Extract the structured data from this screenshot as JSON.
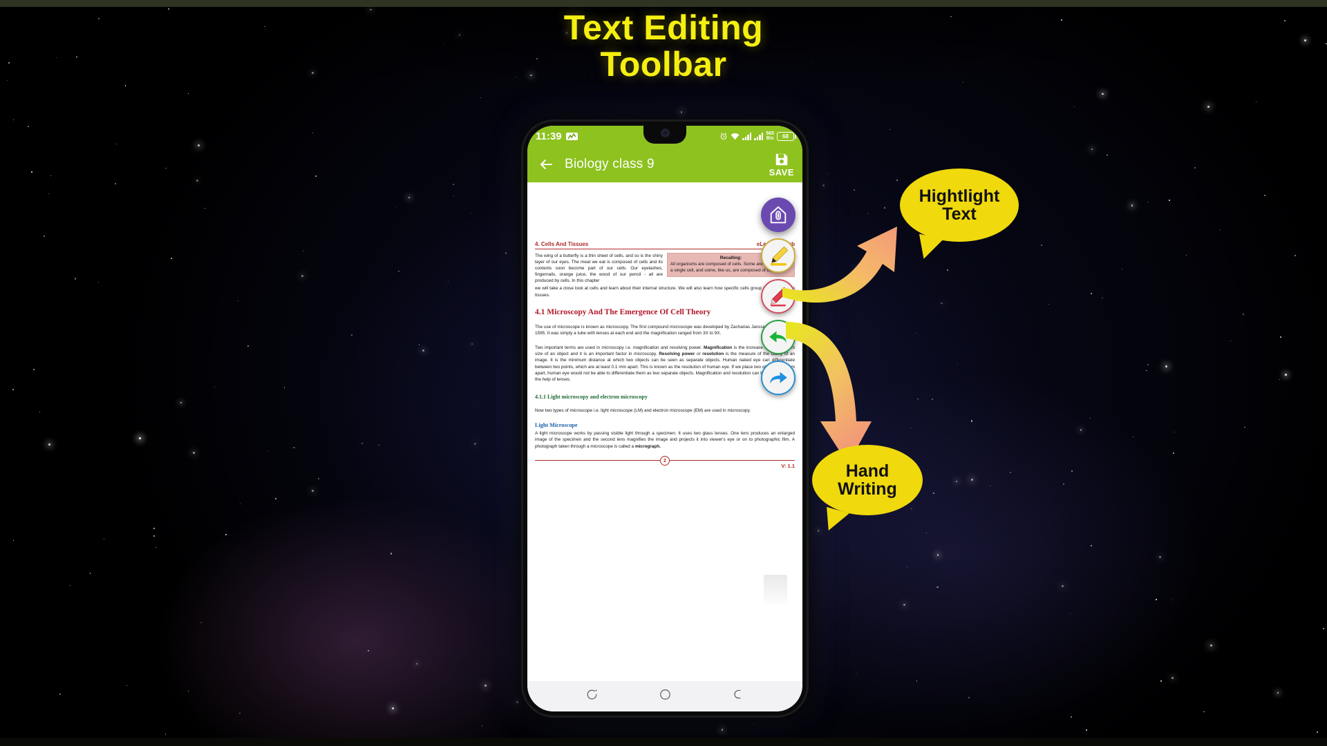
{
  "poster": {
    "headline_line1": "Text Editing",
    "headline_line2": "Toolbar",
    "headline_color": "#f5ef12",
    "background_color": "#000000"
  },
  "callouts": [
    {
      "id": "highlight",
      "line1": "Hightlight",
      "line2": "Text",
      "color": "#f0d90c"
    },
    {
      "id": "handwriting",
      "line1": "Hand",
      "line2": "Writing",
      "color": "#f0d90c"
    }
  ],
  "phone": {
    "status_bar": {
      "time": "11:39",
      "chip_icon": "activity-chart-icon",
      "alarm_icon": "alarm-icon",
      "wifi_icon": "wifi-icon",
      "signal_icon_1": "signal-bars-icon",
      "signal_icon_2": "signal-bars-icon",
      "net_speed_value": "565",
      "net_speed_unit": "B/s",
      "battery_percent": "68",
      "bar_color": "#8dc21f"
    },
    "app_bar": {
      "back_icon": "back-arrow-icon",
      "title": "Biology class 9",
      "save_icon": "save-disk-icon",
      "save_label": "SAVE",
      "bar_color": "#8dc21f"
    },
    "toolbar": [
      {
        "id": "edit",
        "icon": "pencil-outline-icon",
        "label": "Edit",
        "color": "#6a4ab0"
      },
      {
        "id": "highlighter",
        "icon": "yellow-highlighter-icon",
        "label": "Highlight",
        "color": "#f2c744"
      },
      {
        "id": "pen",
        "icon": "red-pen-icon",
        "label": "Hand Writing",
        "color": "#e23b4e"
      },
      {
        "id": "undo",
        "icon": "undo-arrow-icon",
        "label": "Undo",
        "color": "#2e9e45"
      },
      {
        "id": "redo",
        "icon": "redo-arrow-icon",
        "label": "Redo",
        "color": "#2a8fd0"
      }
    ],
    "nav_bar": {
      "recents_icon": "recents-icon",
      "home_icon": "home-circle-icon",
      "back_icon": "back-nav-icon"
    },
    "document": {
      "header_left": "4. Cells And Tissues",
      "header_right": "eLearn.Punjab",
      "intro_left": "The wing of a butterfly is a thin sheet of cells, and so is the shiny layer of our eyes. The meat we eat is composed of cells and its contents soon become part of our cells. Our eyelashes, fingernails, orange juice, the wood of our pencil - all are produced by cells. In this chapter",
      "recalling_title": "Recalling:",
      "recalling_body": "All organisms are composed of cells. Some are composed of a single cell, and some, like us, are composed of cells.",
      "intro_continued": "we will take a close look at cells and learn about their internal structure. We will also learn how specific cells group together to form tissues.",
      "heading_4_1": "4.1 Microscopy And The Emergence Of Cell Theory",
      "para_1": "The use of microscope is known as microscopy. The first compound microscope was developed by Zacharias Janssen, in Holland in 1595. It was simply a tube with lenses at each end and the magnification ranged from 3X to 9X.",
      "para_2_a": "Two important terms are used in microscopy i.e. magnification and resolving power. ",
      "para_2_b1": "Magnification",
      "para_2_c": " is the increase in the apparent size of an object and it is an important factor in microscopy. ",
      "para_2_b2": "Resolving power",
      "para_2_d": " or ",
      "para_2_b3": "resolution",
      "para_2_e": " is the measure of the clarity of an image. It is the minimum distance at which two objects can be seen as separate objects. Human naked eye can differentiate between two points, which are at least 0.1 mm apart. This is known as the resolution of human eye. If we place two objects 0.05 mm apart, human eye would not be able to differentiate them as two separate objects. Magnification and resolution can be increased with the help of lenses.",
      "heading_4_1_1": "4.1.1 Light microscopy and electron microscopy",
      "para_3": "Now two types of microscope i.e. light microscope (LM) and electron microscope (EM) are used in microscopy.",
      "heading_light": "Light Microscope",
      "para_4_a": "A light microscope works by passing visible light through a specimen. It uses two glass lenses. One lens produces an enlarged image of the specimen and the second lens magnifies the image and projects it into viewer's eye or on to photographic film. A photograph taken through a microscope is called a ",
      "para_4_b": "micrograph.",
      "page_number": "2",
      "version": "V: 1.1",
      "heading_red_color": "#b0182a",
      "heading_green_color": "#1d6b34",
      "heading_blue_color": "#1a5fa8"
    }
  }
}
